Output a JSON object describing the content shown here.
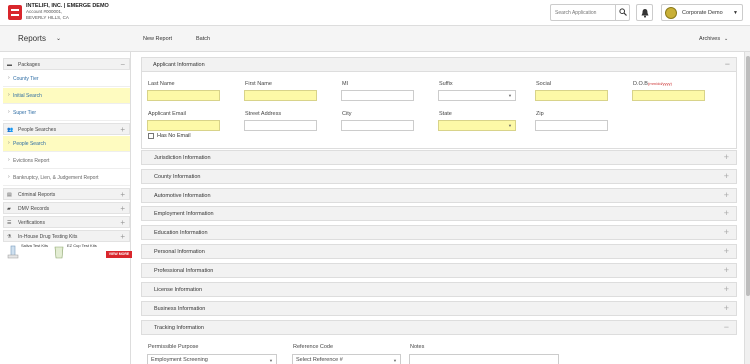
{
  "header": {
    "company_name": "INTELIFI, INC. | EMERGE DEMO",
    "account": "Account #000001,",
    "location": "BEVERLY HILLS, CA",
    "search_placeholder": "Search Application",
    "account_label": "Corporate Demo"
  },
  "subnav": {
    "reports_label": "Reports",
    "new_report": "New Report",
    "batch": "Batch",
    "archives": "Archives"
  },
  "sidebar": {
    "packages": "Packages",
    "package_items": [
      "County Tier",
      "Initial Search",
      "Super Tier"
    ],
    "people_searches": "People Searches",
    "people_items": [
      "People Search",
      "Evictions Report",
      "Bankruptcy, Lien, & Judgement Report"
    ],
    "criminal": "Criminal Reports",
    "dmv": "DMV Records",
    "verifications": "Verifications",
    "drug": "In-House Drug Testing Kits",
    "kits": {
      "saliva": "Saliva Test Kits",
      "cup": "EZ Cup Test Kits",
      "view_more": "VIEW MORE"
    }
  },
  "applicant": {
    "title": "Applicant Information",
    "labels": {
      "last_name": "Last Name",
      "first_name": "First Name",
      "mi": "MI",
      "suffix": "Suffix",
      "social": "Social",
      "dob": "D.O.B",
      "dob_format": "(mm/dd/yyyy)",
      "email": "Applicant Email",
      "street": "Street Address",
      "city": "City",
      "state": "State",
      "zip": "Zip",
      "no_email": "Has No Email"
    }
  },
  "sections": [
    "Jurisdiction Information",
    "County Information",
    "Automotive Information",
    "Employment Information",
    "Education Information",
    "Personal Information",
    "Professional Information",
    "License Information",
    "Business Information",
    "Tracking Information"
  ],
  "tracking": {
    "purpose_label": "Permissible Purpose",
    "purpose_value": "Employment Screening",
    "ref_label": "Reference Code",
    "ref_value": "Select Reference #",
    "notes_label": "Notes"
  },
  "colors": {
    "accent_red": "#d9262c",
    "required_yellow": "#fdf9a7",
    "selected_yellow": "#fefbc0",
    "link_blue": "#2e6da4"
  }
}
